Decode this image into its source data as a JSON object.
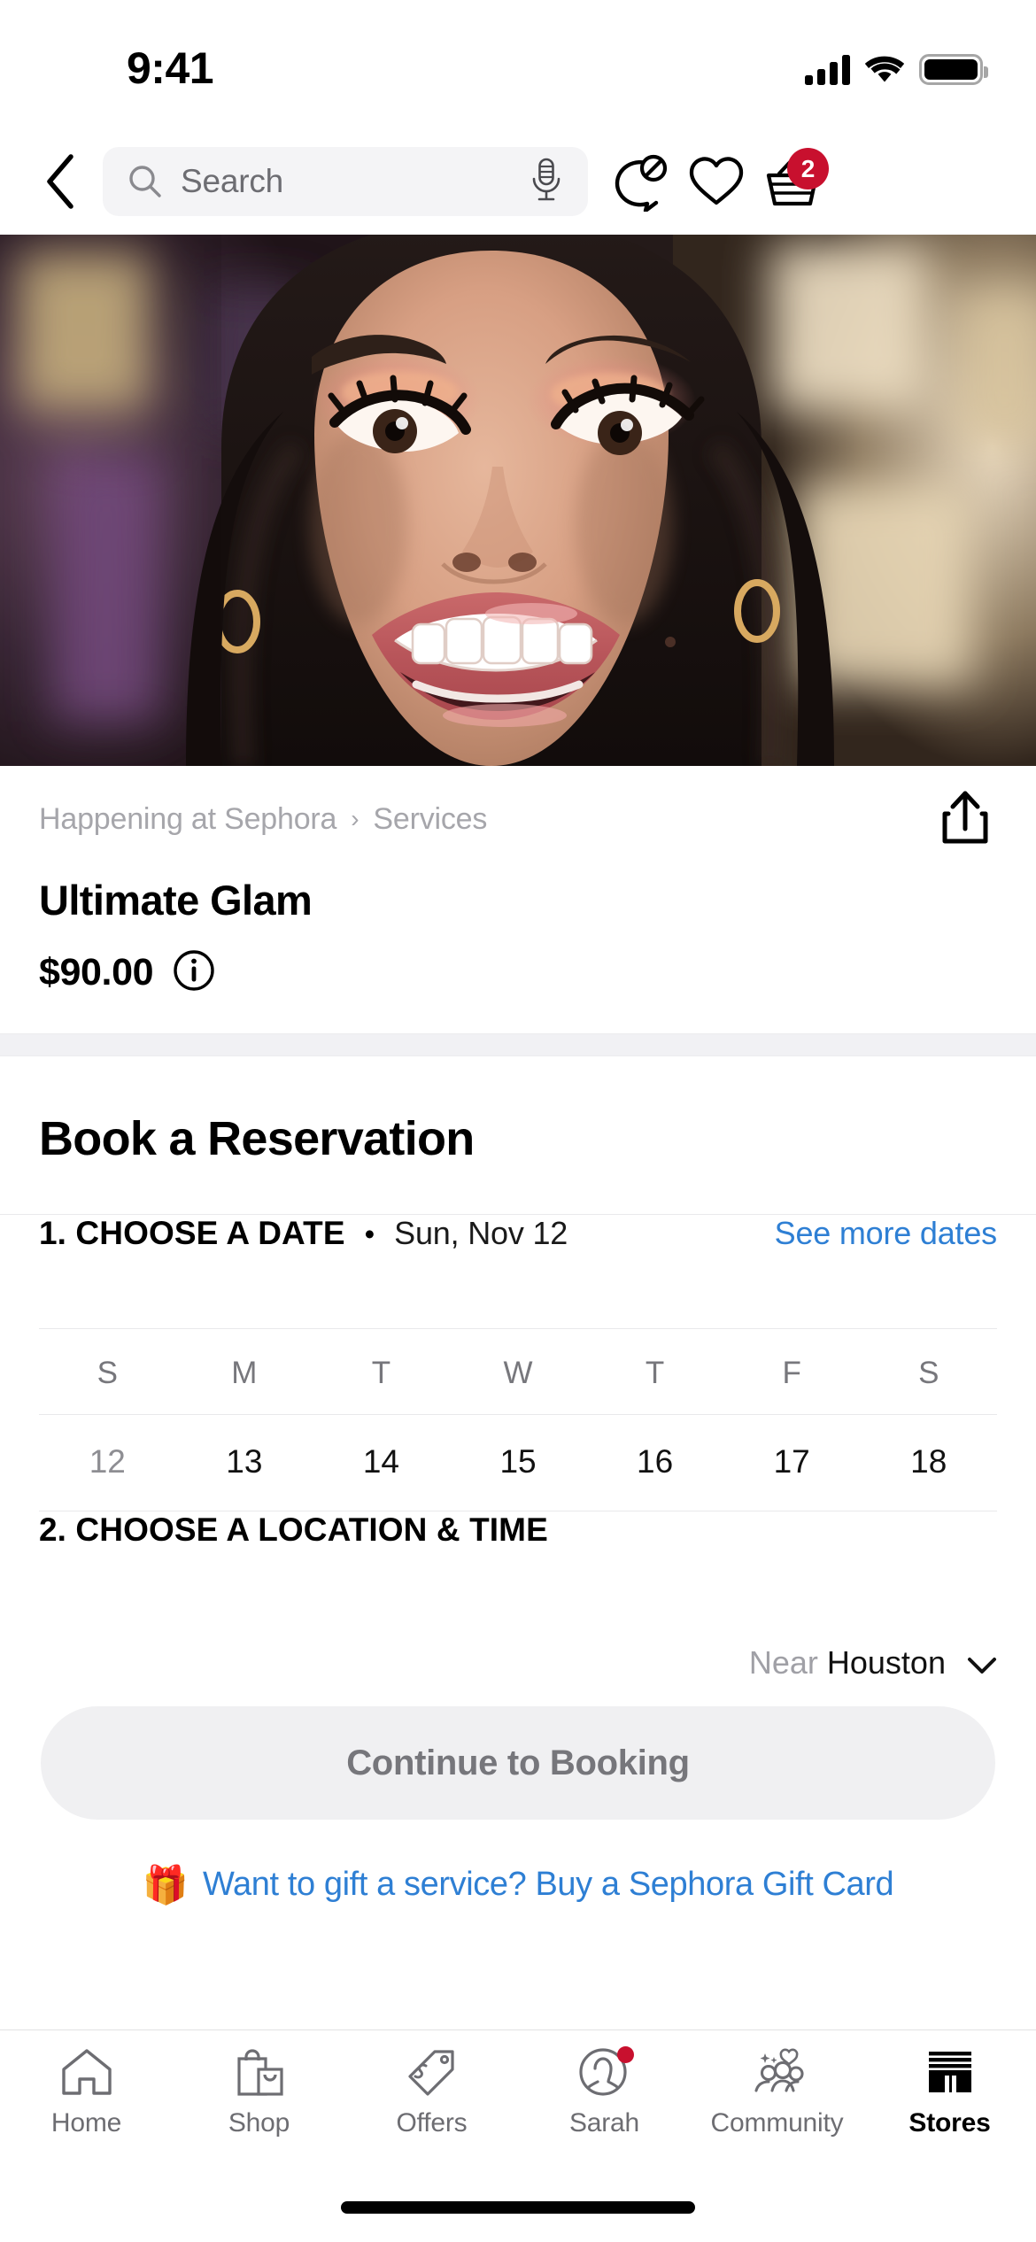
{
  "theme": {
    "brand": "#c8102e",
    "link": "#2e7fd4",
    "muted": "#8e8e93",
    "chip_bg": "#f4f4f6"
  },
  "status_bar": {
    "time": "9:41",
    "signal_icon": "cellular-signal-icon",
    "wifi_icon": "wifi-icon",
    "battery_icon": "battery-full-icon"
  },
  "nav": {
    "back_icon": "back-chevron-icon",
    "search_placeholder": "Search",
    "search_value": "",
    "search_icon": "search-icon",
    "mic_icon": "microphone-icon",
    "chat_icon": "chat-bubble-icon",
    "wishlist_icon": "heart-icon",
    "cart_icon": "basket-icon",
    "cart_count": "2"
  },
  "hero": {
    "alt": "Close-up of a smiling model wearing coral and pink glam eye makeup and glossy lip",
    "cursor": "pointer-dot"
  },
  "product": {
    "breadcrumb": [
      "Happening at Sephora",
      "Services"
    ],
    "breadcrumb_separator": "›",
    "title": "Ultimate Glam",
    "price": "$90.00",
    "info_icon": "info-circle-icon",
    "share_icon": "share-icon"
  },
  "booking": {
    "heading": "Book a Reservation",
    "step1": {
      "title": "1. CHOOSE A DATE",
      "separator": "•",
      "value": "Sun, Nov 12",
      "link": "See more dates"
    },
    "calendar": {
      "dow": [
        "S",
        "M",
        "T",
        "W",
        "T",
        "F",
        "S"
      ],
      "dates": [
        {
          "day": "12",
          "muted": true
        },
        {
          "day": "13",
          "muted": false
        },
        {
          "day": "14",
          "muted": false
        },
        {
          "day": "15",
          "muted": false
        },
        {
          "day": "16",
          "muted": false
        },
        {
          "day": "17",
          "muted": false
        },
        {
          "day": "18",
          "muted": false
        }
      ]
    },
    "step2": {
      "title": "2. CHOOSE A LOCATION & TIME"
    },
    "location": {
      "prefix": "Near",
      "city": "Houston",
      "chevron_icon": "chevron-down-icon"
    },
    "cta_label": "Continue to Booking",
    "gift": {
      "emoji": "🎁",
      "text": "Want to gift a service? Buy a Sephora Gift Card"
    }
  },
  "tabbar": {
    "items": [
      {
        "label": "Home",
        "icon": "home-icon",
        "active": false,
        "badge": false
      },
      {
        "label": "Shop",
        "icon": "shopping-bag-icon",
        "active": false,
        "badge": false
      },
      {
        "label": "Offers",
        "icon": "price-tag-icon",
        "active": false,
        "badge": false
      },
      {
        "label": "Sarah",
        "icon": "account-avatar-icon",
        "active": false,
        "badge": true
      },
      {
        "label": "Community",
        "icon": "community-people-icon",
        "active": false,
        "badge": false
      },
      {
        "label": "Stores",
        "icon": "storefront-icon",
        "active": true,
        "badge": false
      }
    ]
  }
}
